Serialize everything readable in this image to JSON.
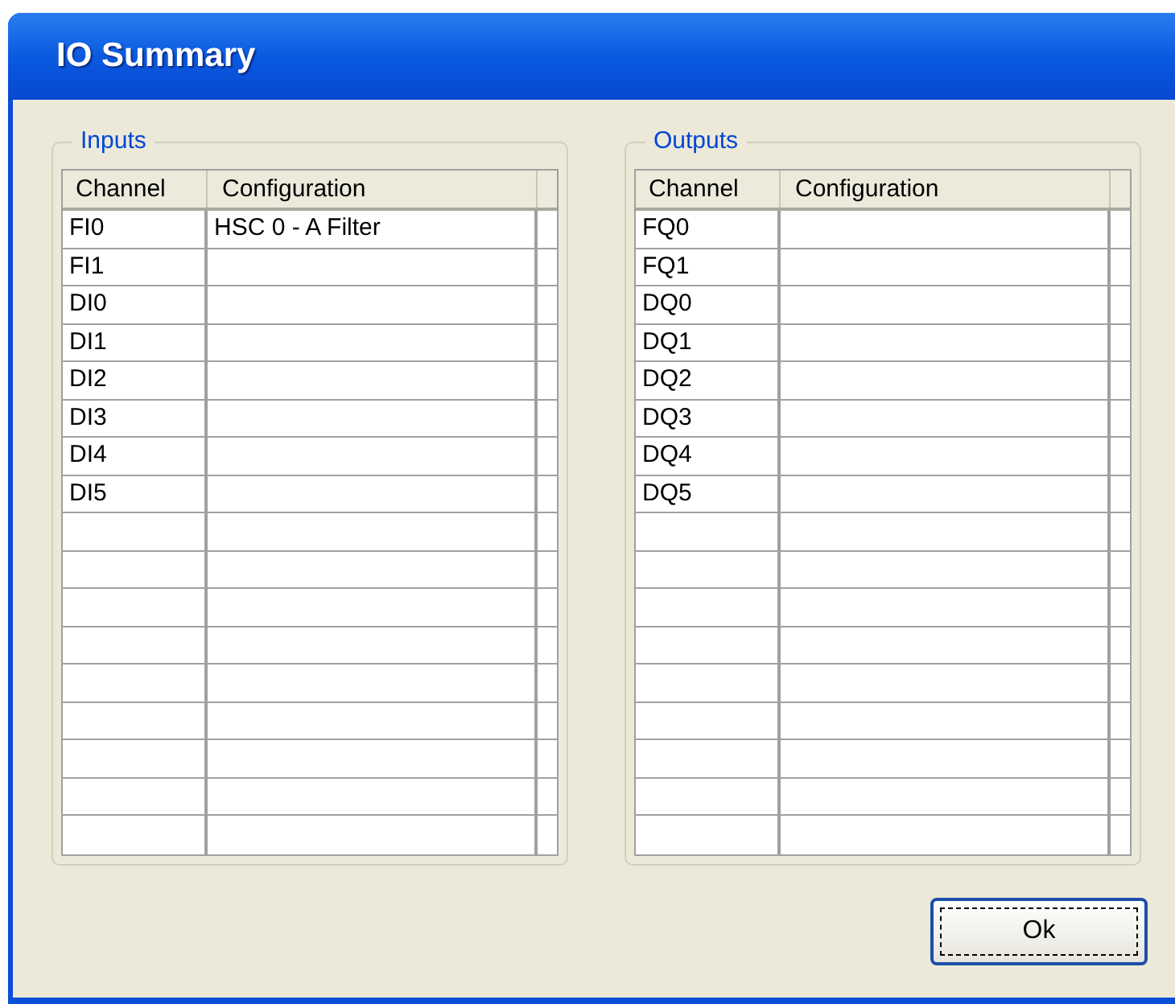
{
  "window": {
    "title": "IO Summary"
  },
  "panels": [
    {
      "title": "Inputs",
      "columns": [
        "Channel",
        "Configuration"
      ],
      "rows": [
        {
          "channel": "FI0",
          "configuration": "HSC 0 - A Filter"
        },
        {
          "channel": "FI1"
        },
        {
          "channel": "DI0"
        },
        {
          "channel": "DI1"
        },
        {
          "channel": "DI2"
        },
        {
          "channel": "DI3"
        },
        {
          "channel": "DI4"
        },
        {
          "channel": "DI5"
        }
      ]
    },
    {
      "title": "Outputs",
      "columns": [
        "Channel",
        "Configuration"
      ],
      "rows": [
        {
          "channel": "FQ0"
        },
        {
          "channel": "FQ1"
        },
        {
          "channel": "DQ0"
        },
        {
          "channel": "DQ1"
        },
        {
          "channel": "DQ2"
        },
        {
          "channel": "DQ3"
        },
        {
          "channel": "DQ4"
        },
        {
          "channel": "DQ5"
        }
      ]
    }
  ],
  "buttons": [
    "Ok"
  ]
}
